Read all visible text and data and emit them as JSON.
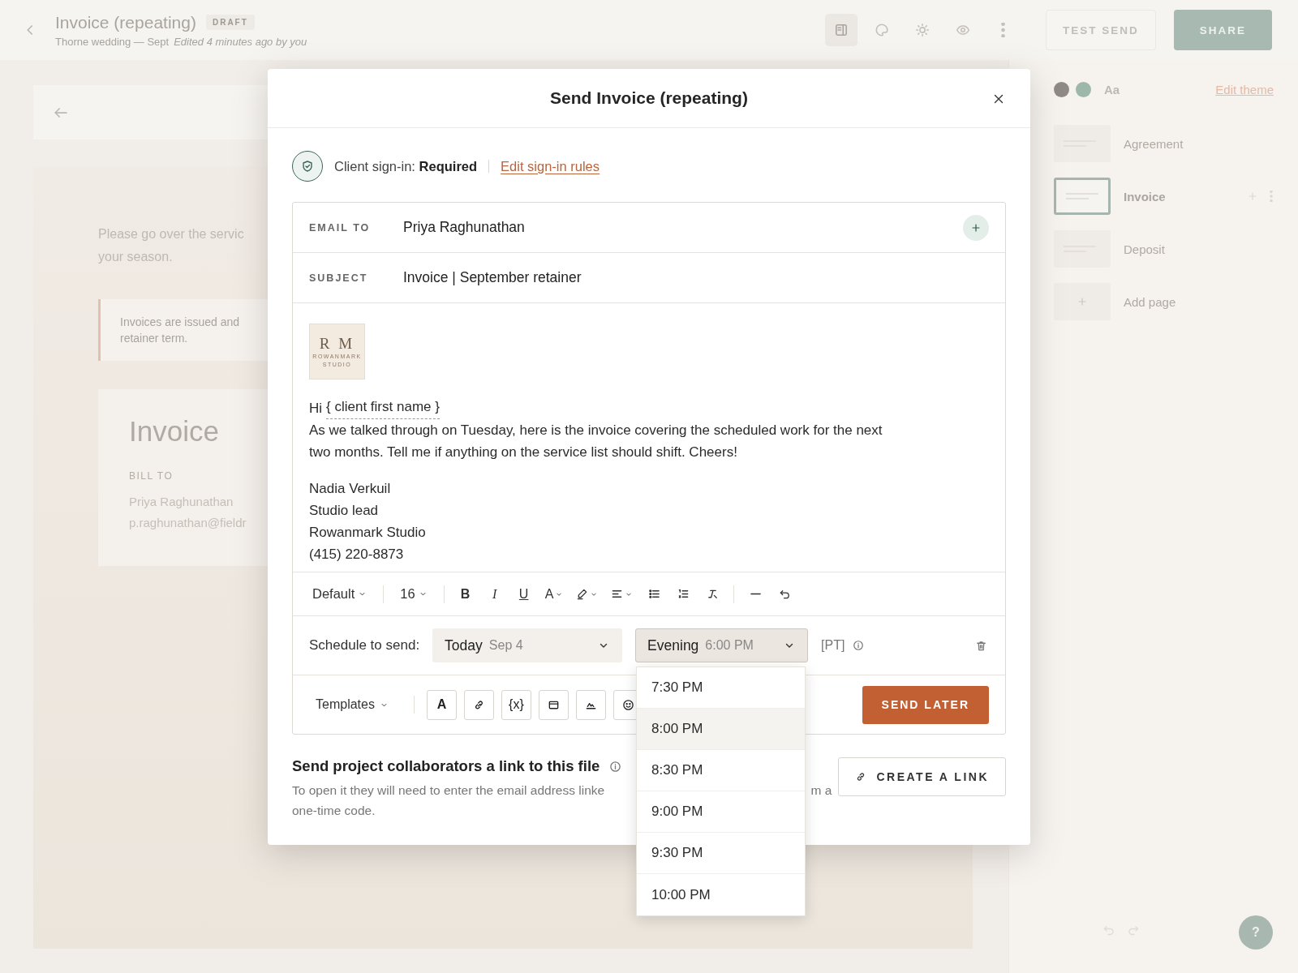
{
  "top_bar": {
    "title": "Invoice (repeating)",
    "badge": "DRAFT",
    "subtitle": "Thorne wedding — Sept",
    "edited": "Edited 4 minutes ago by you",
    "tools": [
      {
        "kind": "layout",
        "selected": true
      },
      {
        "kind": "palette",
        "selected": false
      },
      {
        "kind": "sun",
        "selected": false
      },
      {
        "kind": "eye",
        "selected": false
      },
      {
        "kind": "more",
        "selected": false
      }
    ],
    "buttons": [
      {
        "label": "TEST SEND",
        "kind": "outline"
      },
      {
        "label": "SHARE",
        "kind": "primary"
      }
    ]
  },
  "canvas": {
    "intro_lines": [
      "Please go over the servic",
      "your season."
    ],
    "note_lines": [
      "Invoices are issued and",
      "retainer term."
    ],
    "invoice": {
      "title": "Invoice",
      "bill_to_label": "BILL TO",
      "name": "Priya Raghunathan",
      "email": "p.raghunathan@fieldr"
    }
  },
  "sidebar": {
    "help": "?",
    "swatches": [
      {
        "color": "#8f8a86"
      },
      {
        "color": "#9db8ab"
      }
    ],
    "font_sample": "Aa",
    "edit_link": "Edit theme",
    "pages": [
      {
        "label": "Agreement",
        "kind": "page",
        "selected": false
      },
      {
        "label": "Invoice",
        "kind": "page",
        "selected": true
      },
      {
        "label": "Deposit",
        "kind": "page",
        "selected": false
      },
      {
        "label": "Add page",
        "kind": "add",
        "selected": false
      }
    ]
  },
  "modal": {
    "title": "Send Invoice (repeating)",
    "sign_in": {
      "label": "Client sign-in:",
      "value": "Required",
      "link": "Edit sign-in rules"
    },
    "fields": [
      {
        "label": "EMAIL TO",
        "value": "Priya Raghunathan",
        "kind": "recipients"
      },
      {
        "label": "SUBJECT",
        "value": "Invoice | September retainer",
        "kind": "text"
      }
    ],
    "logo": {
      "monogram": "R M",
      "name_lines": [
        "ROWANMARK",
        "STUDIO"
      ]
    },
    "greeting": "Hi",
    "merge_field": "{ client first name }",
    "body": "As we talked through on Tuesday, here is the invoice covering the scheduled work for the next two months. Tell me if anything on the service list should shift. Cheers!",
    "signature": [
      "Nadia Verkuil",
      "Studio lead",
      "Rowanmark Studio",
      "(415) 220-8873"
    ],
    "format_toolbar": {
      "font": "Default",
      "size": "16",
      "groups": [
        [
          {
            "kind": "bold",
            "label": "B"
          },
          {
            "kind": "italic",
            "label": "I"
          },
          {
            "kind": "underline",
            "label": "U"
          },
          {
            "kind": "text-color",
            "label": "A"
          },
          {
            "kind": "highlight"
          },
          {
            "kind": "align"
          },
          {
            "kind": "bullets"
          },
          {
            "kind": "numbers"
          },
          {
            "kind": "clear"
          }
        ],
        [
          {
            "kind": "rule"
          },
          {
            "kind": "undo"
          }
        ]
      ]
    },
    "schedule": {
      "label": "Schedule to send:",
      "date": {
        "main": "Today",
        "detail": "Sep 4"
      },
      "time": {
        "main": "Evening",
        "detail": "6:00 PM",
        "expanded": true
      },
      "zone": "[PT]",
      "options": [
        {
          "label": "7:30 PM",
          "selected": false
        },
        {
          "label": "8:00 PM",
          "selected": true
        },
        {
          "label": "8:30 PM",
          "selected": false
        },
        {
          "label": "9:00 PM",
          "selected": false
        },
        {
          "label": "9:30 PM",
          "selected": false
        },
        {
          "label": "10:00 PM",
          "selected": false
        }
      ]
    },
    "compose_bar": {
      "templates": "Templates",
      "tools": [
        {
          "kind": "text",
          "label": "A"
        },
        {
          "kind": "link"
        },
        {
          "kind": "variable",
          "label": "{x}"
        },
        {
          "kind": "card"
        },
        {
          "kind": "signature"
        },
        {
          "kind": "emoji"
        }
      ],
      "send": "SEND LATER"
    },
    "collaborators": {
      "heading": "Send project collaborators a link to this file",
      "description_parts": [
        "To open it they will need to enter the email address linke",
        "m a",
        "one-time code."
      ],
      "button": "CREATE A LINK"
    }
  }
}
